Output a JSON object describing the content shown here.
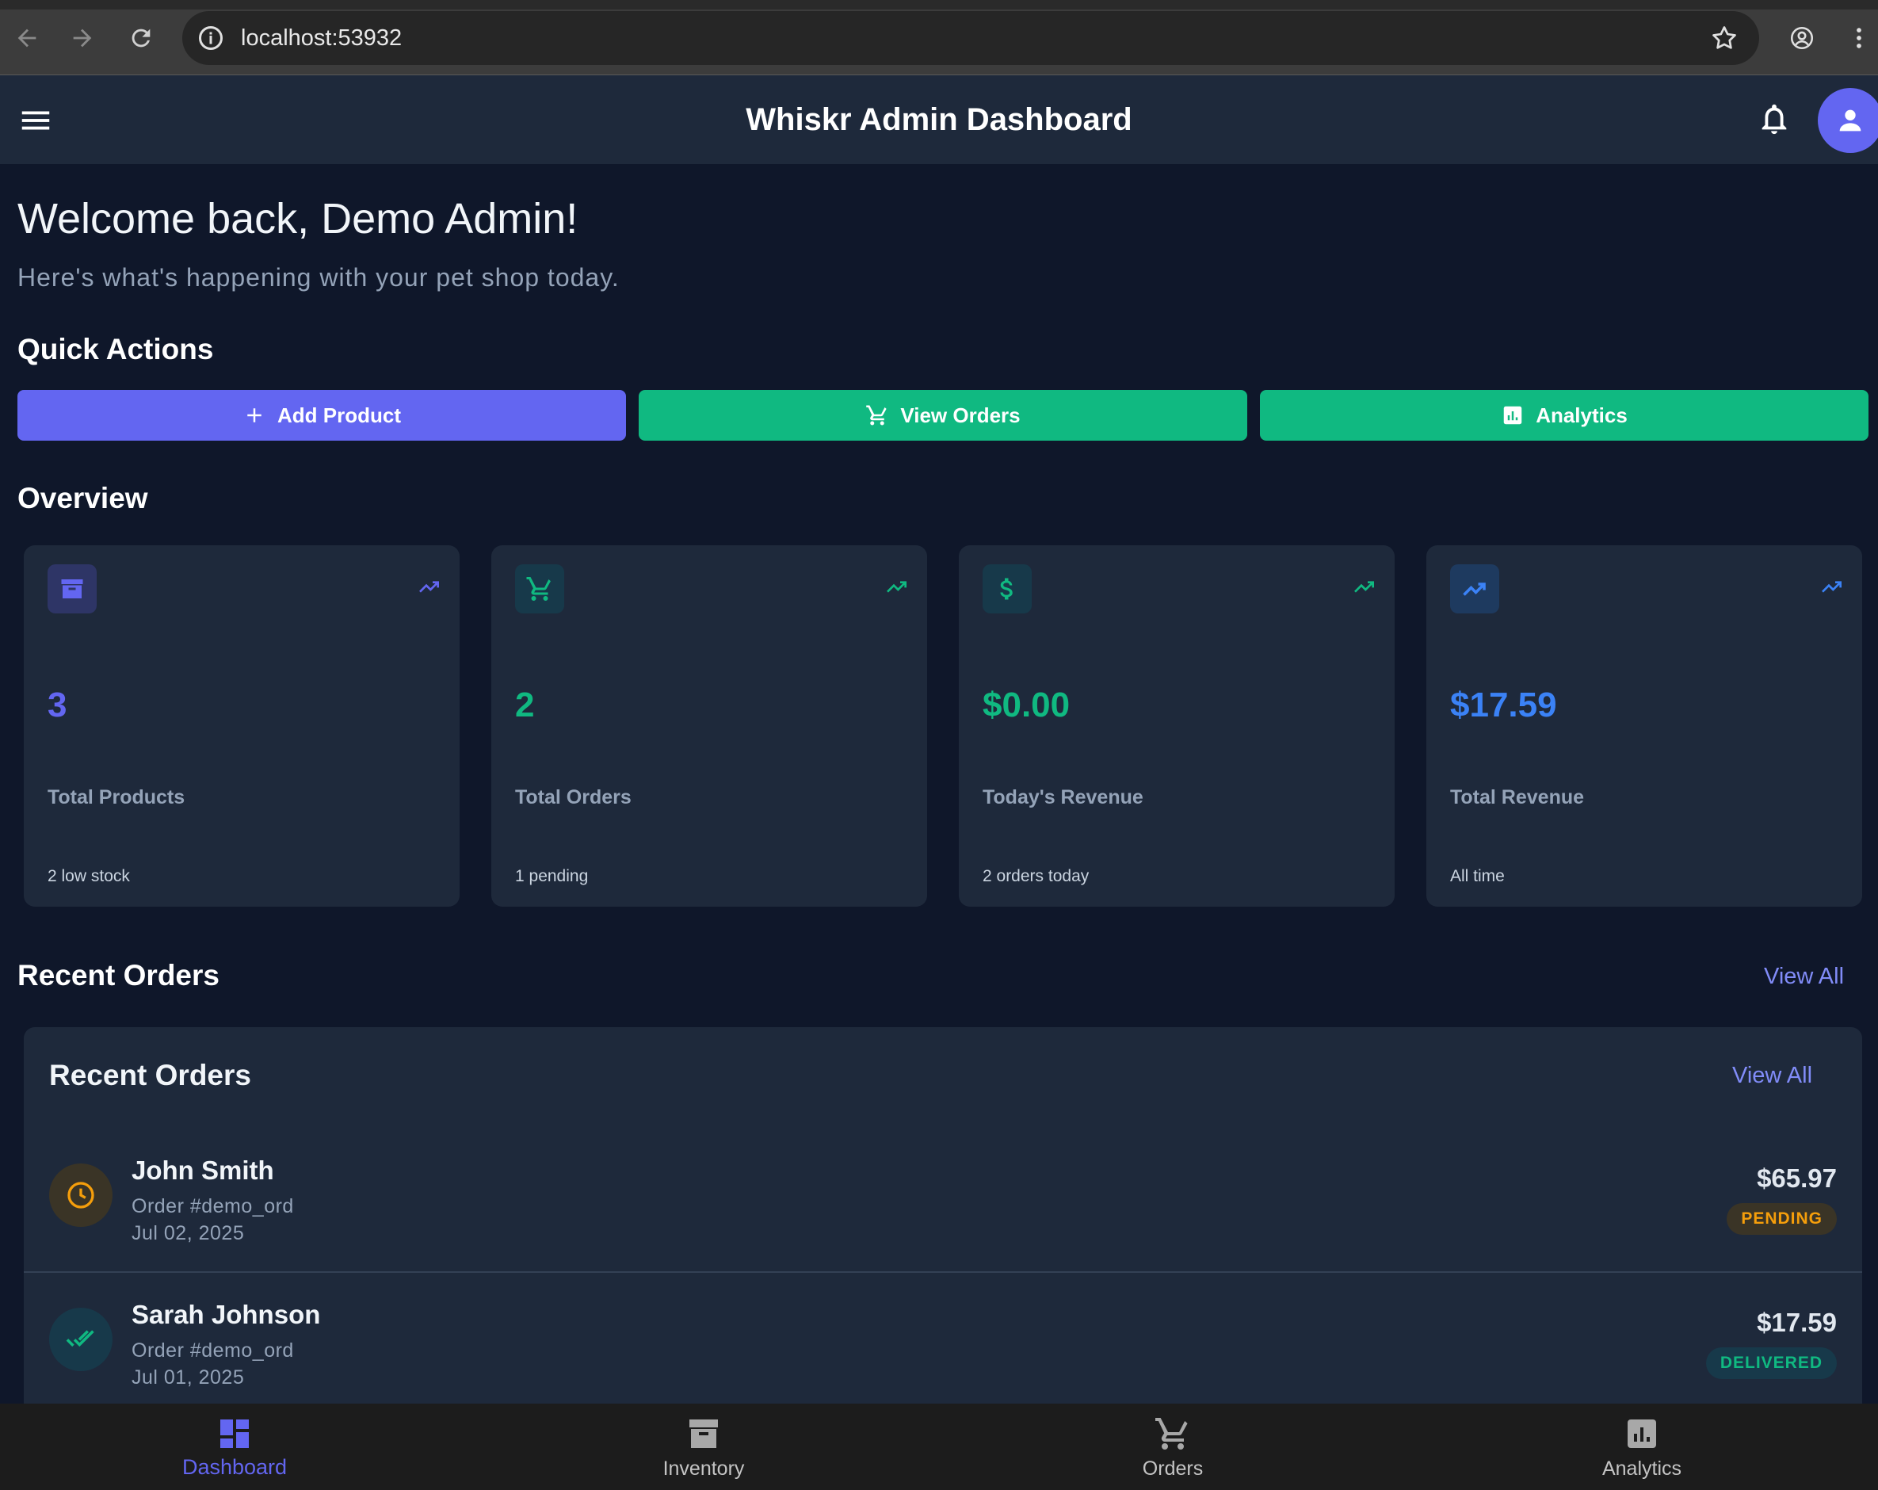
{
  "browser": {
    "url": "localhost:53932"
  },
  "appbar": {
    "title": "Whiskr Admin Dashboard"
  },
  "welcome": {
    "heading": "Welcome back, Demo Admin!",
    "subtitle": "Here's what's happening with your pet shop today."
  },
  "quick_actions": {
    "title": "Quick Actions",
    "buttons": [
      {
        "label": "Add Product",
        "icon": "plus-icon",
        "color": "#6366f1"
      },
      {
        "label": "View Orders",
        "icon": "cart-icon",
        "color": "#10b981"
      },
      {
        "label": "Analytics",
        "icon": "analytics-icon",
        "color": "#10b981"
      }
    ]
  },
  "overview": {
    "title": "Overview",
    "cards": [
      {
        "value": "3",
        "label": "Total Products",
        "sub": "2 low stock",
        "icon": "inventory-icon",
        "color": "#6366f1"
      },
      {
        "value": "2",
        "label": "Total Orders",
        "sub": "1 pending",
        "icon": "cart-icon",
        "color": "#10b981"
      },
      {
        "value": "$0.00",
        "label": "Today's Revenue",
        "sub": "2 orders today",
        "icon": "dollar-icon",
        "color": "#10b981"
      },
      {
        "value": "$17.59",
        "label": "Total Revenue",
        "sub": "All time",
        "icon": "trending-up-icon",
        "color": "#3b82f6"
      }
    ]
  },
  "recent_orders": {
    "section_title": "Recent Orders",
    "view_all": "View All",
    "card_title": "Recent Orders",
    "card_view_all": "View All",
    "orders": [
      {
        "name": "John Smith",
        "order_id": "Order #demo_ord",
        "date": "Jul 02, 2025",
        "amount": "$65.97",
        "status": "PENDING",
        "status_color": "#f59e0b",
        "icon": "clock-icon"
      },
      {
        "name": "Sarah Johnson",
        "order_id": "Order #demo_ord",
        "date": "Jul 01, 2025",
        "amount": "$17.59",
        "status": "DELIVERED",
        "status_color": "#10b981",
        "icon": "done-all-icon"
      }
    ]
  },
  "bottom_nav": {
    "items": [
      {
        "label": "Dashboard",
        "icon": "dashboard-icon",
        "active": true
      },
      {
        "label": "Inventory",
        "icon": "inventory-icon",
        "active": false
      },
      {
        "label": "Orders",
        "icon": "cart-icon",
        "active": false
      },
      {
        "label": "Analytics",
        "icon": "analytics-icon",
        "active": false
      }
    ]
  }
}
